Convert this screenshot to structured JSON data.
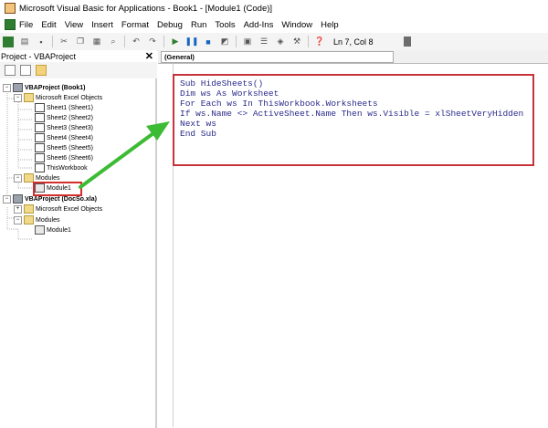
{
  "window": {
    "title": "Microsoft Visual Basic for Applications - Book1 - [Module1 (Code)]"
  },
  "menu": {
    "items": [
      "File",
      "Edit",
      "View",
      "Insert",
      "Format",
      "Debug",
      "Run",
      "Tools",
      "Add-Ins",
      "Window",
      "Help"
    ]
  },
  "toolbar": {
    "status": "Ln 7, Col 8"
  },
  "project_panel": {
    "title": "Project - VBAProject",
    "close": "✕"
  },
  "tree": {
    "book1_project": "VBAProject (Book1)",
    "excel_objects_1": "Microsoft Excel Objects",
    "sheets": [
      "Sheet1 (Sheet1)",
      "Sheet2 (Sheet2)",
      "Sheet3 (Sheet3)",
      "Sheet4 (Sheet4)",
      "Sheet5 (Sheet5)",
      "Sheet6 (Sheet6)"
    ],
    "thisworkbook": "ThisWorkbook",
    "modules_1": "Modules",
    "module1_a": "Module1",
    "docso_project": "VBAProject (DocSo.xla)",
    "excel_objects_2": "Microsoft Excel Objects",
    "modules_2": "Modules",
    "module1_b": "Module1"
  },
  "code_window": {
    "object_combo": "(General)",
    "lines": [
      "Sub HideSheets()",
      "Dim ws As Worksheet",
      "For Each ws In ThisWorkbook.Worksheets",
      "If ws.Name <> ActiveSheet.Name Then ws.Visible = xlSheetVeryHidden",
      "Next ws",
      "End Sub"
    ]
  },
  "colors": {
    "highlight_box": "#d42d2d",
    "arrow": "#3dbb34"
  }
}
